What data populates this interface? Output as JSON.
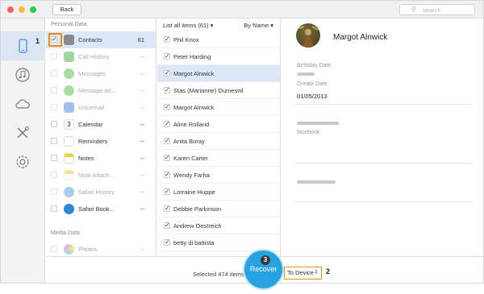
{
  "toolbar": {
    "back_label": "Back",
    "search_placeholder": "search",
    "search_icon": "magnifier"
  },
  "window_controls": {
    "close_color": "#fc605c",
    "minimize_color": "#fdbc40",
    "zoom_color": "#34c84a"
  },
  "nav_icons": [
    "phone-icon",
    "music-icon",
    "cloud-icon",
    "tools-icon",
    "settings-icon"
  ],
  "categories": {
    "personal_header": "Personal Data",
    "media_header": "Media Data",
    "items": [
      {
        "label": "Contacts",
        "count": "61",
        "checked": true,
        "selected": true,
        "disabled": false,
        "icon": "contacts"
      },
      {
        "label": "Call History",
        "count": "--",
        "checked": false,
        "selected": false,
        "disabled": true,
        "icon": "phone"
      },
      {
        "label": "Messages",
        "count": "--",
        "checked": false,
        "selected": false,
        "disabled": true,
        "icon": "messages"
      },
      {
        "label": "Message Att...",
        "count": "--",
        "checked": false,
        "selected": false,
        "disabled": true,
        "icon": "messages"
      },
      {
        "label": "Voicemail",
        "count": "--",
        "checked": false,
        "selected": false,
        "disabled": true,
        "icon": "voicemail"
      },
      {
        "label": "Calendar",
        "count": "--",
        "checked": false,
        "selected": false,
        "disabled": false,
        "icon": "calendar"
      },
      {
        "label": "Reminders",
        "count": "--",
        "checked": false,
        "selected": false,
        "disabled": false,
        "icon": "reminders"
      },
      {
        "label": "Notes",
        "count": "--",
        "checked": false,
        "selected": false,
        "disabled": false,
        "icon": "notes"
      },
      {
        "label": "Note Attach...",
        "count": "--",
        "checked": false,
        "selected": false,
        "disabled": true,
        "icon": "notes"
      },
      {
        "label": "Safari History",
        "count": "--",
        "checked": false,
        "selected": false,
        "disabled": true,
        "icon": "safari"
      },
      {
        "label": "Safari Book...",
        "count": "--",
        "checked": false,
        "selected": false,
        "disabled": false,
        "icon": "safari"
      }
    ],
    "media_items": [
      {
        "label": "Photos",
        "count": "--",
        "checked": false,
        "disabled": true,
        "icon": "photos"
      }
    ],
    "calendar_icon_day": "3"
  },
  "list": {
    "header_label": "List all items (61)",
    "sort_label": "By Name",
    "items": [
      {
        "name": "Phil Knox",
        "selected": false
      },
      {
        "name": "Peter Harding",
        "selected": false
      },
      {
        "name": "Margot Alnwick",
        "selected": true
      },
      {
        "name": "Stas (Marianne) Dumesnil",
        "selected": false
      },
      {
        "name": "Margot Alnwick",
        "selected": false
      },
      {
        "name": "Aline Rolland",
        "selected": false
      },
      {
        "name": "Anita Boray",
        "selected": false
      },
      {
        "name": "Karen Carter",
        "selected": false
      },
      {
        "name": "Wendy Farha",
        "selected": false
      },
      {
        "name": "Lorraine Huppe",
        "selected": false
      },
      {
        "name": "Debbie Parkinson",
        "selected": false
      },
      {
        "name": "Andrew Oestreich",
        "selected": false
      },
      {
        "name": "betty di battista",
        "selected": false
      }
    ]
  },
  "detail": {
    "name": "Margot Alnwick",
    "birthday_label": "Birthday Date",
    "create_label": "Create Date",
    "create_value": "01/05/2013",
    "facebook_label": "facebook"
  },
  "footer": {
    "selected_text": "Selected 474 items",
    "recover_label": "Recover",
    "target_label": "To Device",
    "target_arrow": "⇕"
  },
  "markers": {
    "m1": "1",
    "m2": "2",
    "m3": "3"
  },
  "accent": "#27a3e2",
  "highlight": "#f08a16"
}
